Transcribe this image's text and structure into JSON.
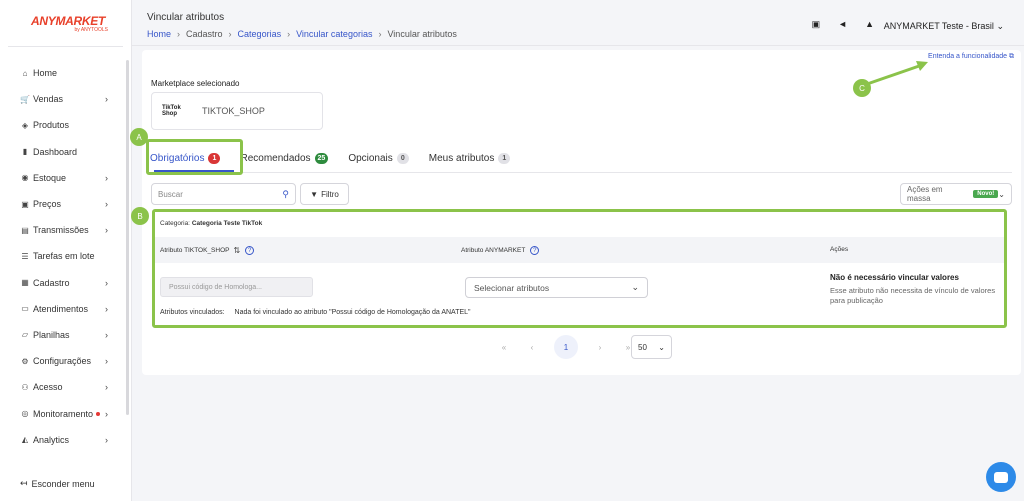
{
  "app": {
    "brand": "ANYMARKET",
    "brand_sub": "by ANYTOOLS"
  },
  "sidebar": {
    "items": [
      {
        "label": "Home",
        "icon": "home-icon",
        "glyph": "⌂",
        "chevron": ""
      },
      {
        "label": "Vendas",
        "icon": "cart-icon",
        "glyph": "🛒",
        "chevron": "›"
      },
      {
        "label": "Produtos",
        "icon": "tag-icon",
        "glyph": "◈",
        "chevron": ""
      },
      {
        "label": "Dashboard",
        "icon": "bar-chart-icon",
        "glyph": "▮",
        "chevron": ""
      },
      {
        "label": "Estoque",
        "icon": "box-icon",
        "glyph": "◉",
        "chevron": "›"
      },
      {
        "label": "Preços",
        "icon": "money-icon",
        "glyph": "▣",
        "chevron": "›"
      },
      {
        "label": "Transmissões",
        "icon": "transmission-icon",
        "glyph": "▤",
        "chevron": "›"
      },
      {
        "label": "Tarefas em lote",
        "icon": "list-icon",
        "glyph": "☰",
        "chevron": ""
      },
      {
        "label": "Cadastro",
        "icon": "register-icon",
        "glyph": "▦",
        "chevron": "›"
      },
      {
        "label": "Atendimentos",
        "icon": "chat-icon",
        "glyph": "▭",
        "chevron": "›"
      },
      {
        "label": "Planilhas",
        "icon": "spreadsheet-icon",
        "glyph": "▱",
        "chevron": "›"
      },
      {
        "label": "Configurações",
        "icon": "gear-icon",
        "glyph": "⚙",
        "chevron": "›"
      },
      {
        "label": "Acesso",
        "icon": "users-icon",
        "glyph": "⚇",
        "chevron": "›"
      },
      {
        "label": "Monitoramento",
        "icon": "monitor-icon",
        "glyph": "◎",
        "chevron": "›"
      },
      {
        "label": "Analytics",
        "icon": "analytics-icon",
        "glyph": "◭",
        "chevron": "›"
      }
    ],
    "hide_menu": "Esconder menu"
  },
  "header": {
    "title": "Vincular atributos",
    "breadcrumb": [
      "Home",
      "Cadastro",
      "Categorias",
      "Vincular categorias",
      "Vincular atributos"
    ],
    "user": "ANYMARKET Teste - Brasil"
  },
  "main": {
    "help_link": "Entenda a funcionalidade",
    "marketplace_label": "Marketplace selecionado",
    "marketplace_logo": "TikTok Shop",
    "marketplace_name": "TIKTOK_SHOP",
    "tabs": [
      {
        "label": "Obrigatórios",
        "count": "1",
        "color": "red"
      },
      {
        "label": "Recomendados",
        "count": "25",
        "color": "green"
      },
      {
        "label": "Opcionais",
        "count": "0",
        "color": "gray"
      },
      {
        "label": "Meus atributos",
        "count": "1",
        "color": "gray"
      }
    ],
    "search_placeholder": "Buscar",
    "filter_label": "Filtro",
    "bulk_label": "Ações em massa",
    "bulk_badge": "Novo!",
    "table": {
      "category_prefix": "Categoria:",
      "category_name": "Categoria Teste TikTok",
      "col1": "Atributo TIKTOK_SHOP",
      "col2": "Atributo ANYMARKET",
      "col3": "Ações",
      "attr_value": "Possui código de Homologa...",
      "select_placeholder": "Selecionar atributos",
      "no_need_title": "Não é necessário vincular valores",
      "no_need_desc": "Esse atributo não necessita de vínculo de valores para publicação",
      "linked_label": "Atributos vinculados:",
      "linked_value": "Nada foi vinculado ao atributo \"Possui código de Homologação da ANATEL\""
    },
    "pager": {
      "first": "«",
      "prev": "‹",
      "current": "1",
      "next": "›",
      "last": "»",
      "per_page": "50"
    }
  },
  "annotations": {
    "a": "A",
    "b": "B",
    "c": "C",
    "color": "#8bc34a"
  }
}
